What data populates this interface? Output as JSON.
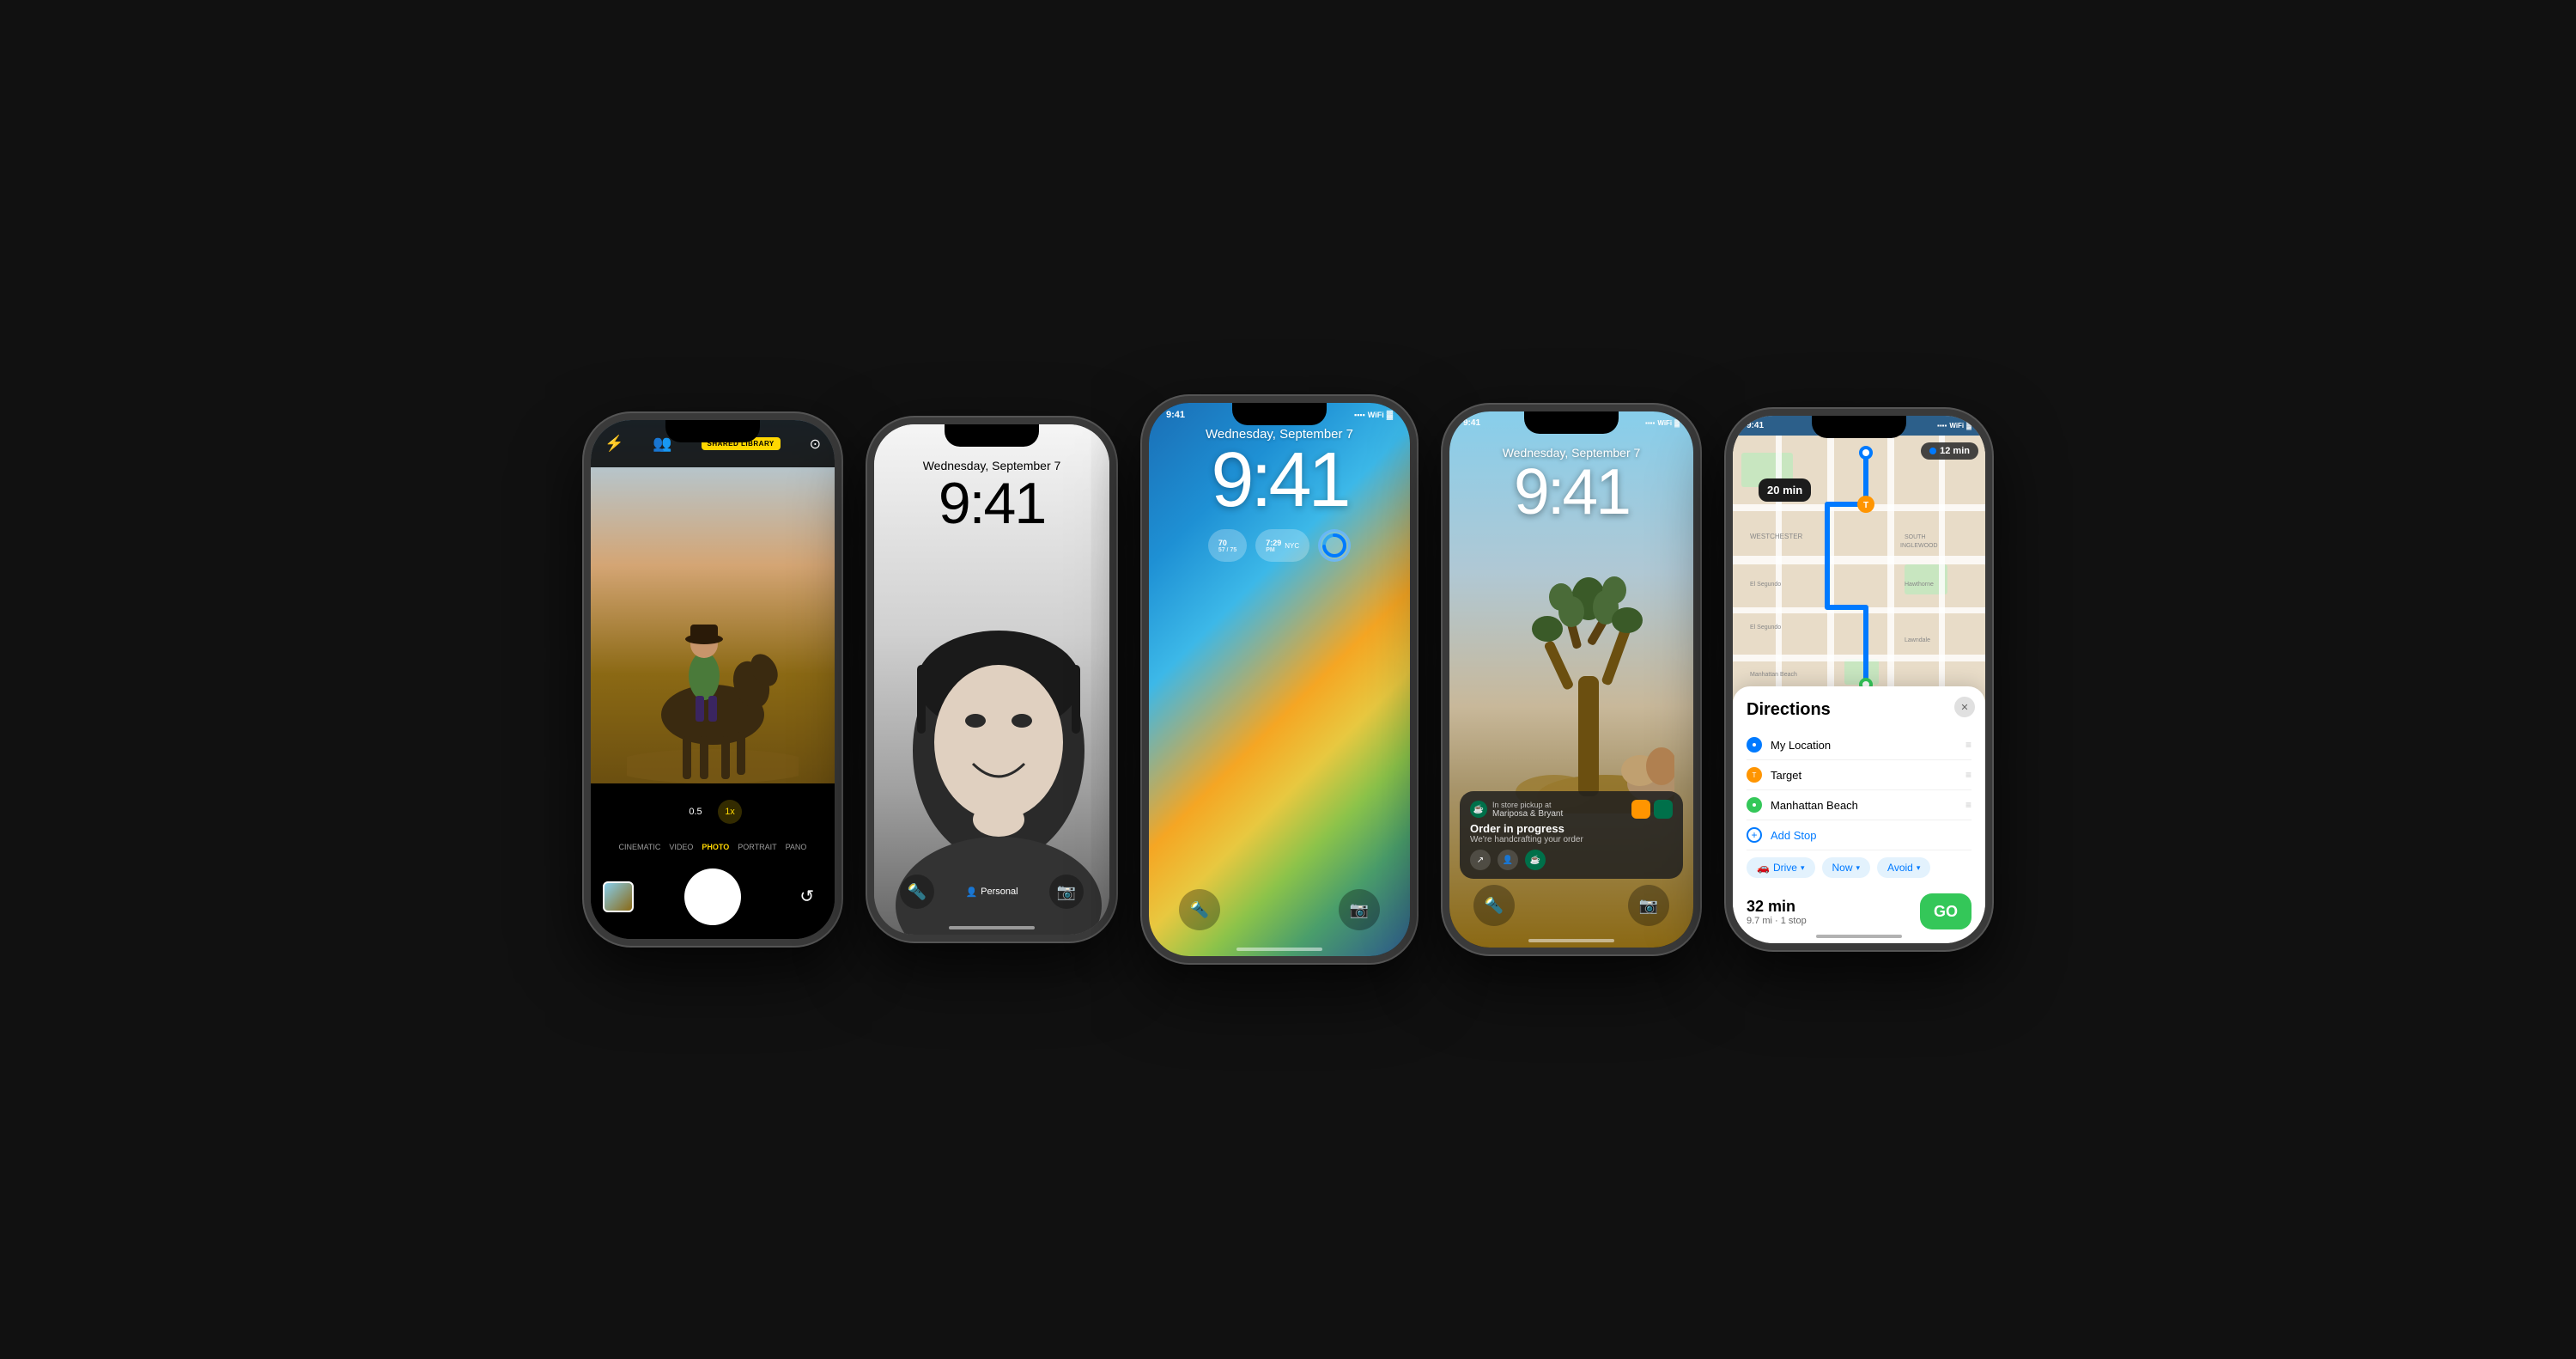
{
  "page": {
    "bg_color": "#111111"
  },
  "phone1": {
    "label": "camera-phone",
    "badge": "SHARED LIBRARY",
    "modes": [
      "CINEMATIC",
      "VIDEO",
      "PHOTO",
      "PORTRAIT",
      "PANO"
    ],
    "active_mode": "PHOTO",
    "zoom_0_5": "0.5",
    "zoom_1x": "1x"
  },
  "phone2": {
    "label": "bw-lockscreen",
    "date": "Wednesday, September 7",
    "time": "9:41",
    "profile_label": "Personal"
  },
  "phone3": {
    "label": "color-lockscreen",
    "status_time": "9:41",
    "date": "Wednesday, September 7",
    "time": "9:41",
    "widget_temp_high": "70",
    "widget_temp_range": "57 / 75",
    "widget_time": "7:29",
    "widget_period": "PM",
    "widget_city": "NYC"
  },
  "phone4": {
    "label": "joshua-tree-lockscreen",
    "date": "Wednesday, September 7",
    "time": "9:41",
    "notif_store": "In store pickup at",
    "notif_location": "Mariposa & Bryant",
    "notif_title": "Order in progress",
    "notif_body": "We're handcrafting your order"
  },
  "phone5": {
    "label": "maps-phone",
    "status_time": "9:41",
    "route_time": "12 min",
    "eta_min": "20 min",
    "directions_title": "Directions",
    "stop1": "My Location",
    "stop2": "Target",
    "stop3": "Manhattan Beach",
    "add_stop": "Add Stop",
    "transport_mode": "Drive",
    "transport_modifier1": "Now",
    "transport_modifier2": "Avoid",
    "eta": "32 min",
    "eta_detail": "9.7 mi · 1 stop",
    "go_label": "GO"
  }
}
